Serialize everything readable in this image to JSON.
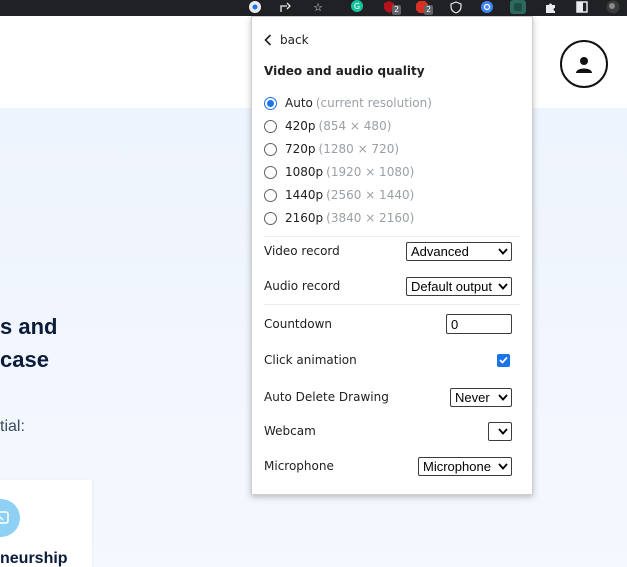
{
  "toolbar": {
    "icons": [
      "chrome-icon",
      "share-icon",
      "star-icon",
      "grammarly-icon",
      "ublock-icon",
      "adblock-icon",
      "shield-icon",
      "at-icon",
      "extension-icon",
      "puzzle-icon",
      "window-icon",
      "profile-icon"
    ],
    "badges": [
      "2",
      "2"
    ]
  },
  "page": {
    "heading_line1": "s and",
    "heading_line2": "case",
    "subtext": "tial:",
    "card_title": "neurship"
  },
  "popup": {
    "back_label": "back",
    "section_title": "Video and audio quality",
    "resolutions": [
      {
        "label": "Auto",
        "detail": "(current resolution)",
        "checked": true
      },
      {
        "label": "420p",
        "detail": "(854 × 480)",
        "checked": false
      },
      {
        "label": "720p",
        "detail": "(1280 × 720)",
        "checked": false
      },
      {
        "label": "1080p",
        "detail": "(1920 × 1080)",
        "checked": false
      },
      {
        "label": "1440p",
        "detail": "(2560 × 1440)",
        "checked": false
      },
      {
        "label": "2160p",
        "detail": "(3840 × 2160)",
        "checked": false
      }
    ],
    "video_record": {
      "label": "Video record",
      "value": "Advanced"
    },
    "audio_record": {
      "label": "Audio record",
      "value": "Default output"
    },
    "countdown": {
      "label": "Countdown",
      "value": "0"
    },
    "click_animation": {
      "label": "Click animation",
      "checked": true
    },
    "auto_delete": {
      "label": "Auto Delete Drawing",
      "value": "Never"
    },
    "webcam": {
      "label": "Webcam",
      "value": ""
    },
    "microphone": {
      "label": "Microphone",
      "value": "Microphone"
    }
  },
  "colors": {
    "accent": "#1a73e8",
    "toolbar_bg": "#202124",
    "page_tint": "#eef4fd",
    "heading": "#0b1b3a",
    "muted": "#9aa0a6"
  }
}
